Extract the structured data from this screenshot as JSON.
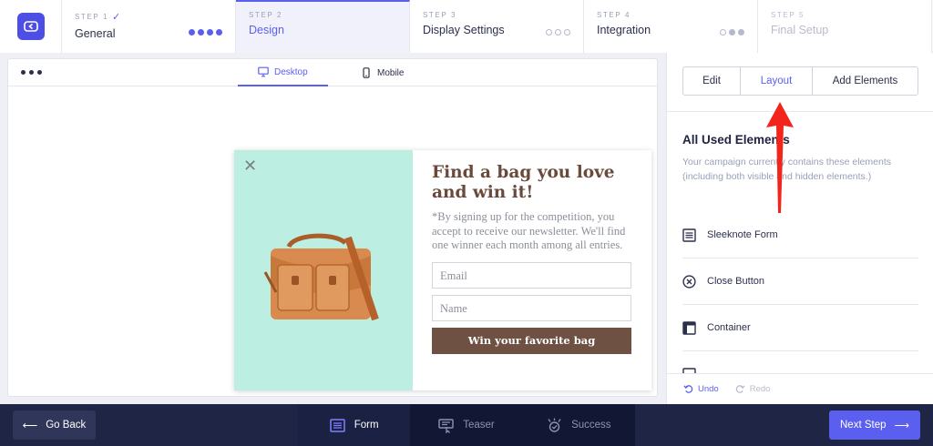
{
  "steps": [
    {
      "label": "STEP 1",
      "name": "General",
      "completed": true,
      "progress_dots": [
        "filled",
        "filled",
        "filled",
        "filled"
      ]
    },
    {
      "label": "STEP 2",
      "name": "Design",
      "active": true
    },
    {
      "label": "STEP 3",
      "name": "Display Settings",
      "progress_dots": [
        "empty",
        "empty",
        "empty"
      ]
    },
    {
      "label": "STEP 4",
      "name": "Integration",
      "progress_dots": [
        "grey",
        "grey",
        "filled-grey"
      ]
    },
    {
      "label": "STEP 5",
      "name": "Final Setup",
      "disabled": true
    }
  ],
  "preview": {
    "device_tabs": [
      {
        "label": "Desktop",
        "icon": "desktop-icon",
        "active": true
      },
      {
        "label": "Mobile",
        "icon": "mobile-icon"
      }
    ],
    "popup": {
      "title": "Find a bag you love and win it!",
      "text": "*By signing up for the competition, you accept to receive our newsletter. We'll find one winner each month among all entries.",
      "email_placeholder": "Email",
      "name_placeholder": "Name",
      "cta": "Win your favorite bag",
      "left_bg": "#bdeee2",
      "cta_color": "#6e5142",
      "title_color": "#6a4a3b"
    }
  },
  "sidebar": {
    "tabs": [
      "Edit",
      "Layout",
      "Add Elements"
    ],
    "active_tab": "Layout",
    "title": "All Used Elements",
    "description": "Your campaign currently contains these elements (including both visible and hidden elements.)",
    "elements": [
      {
        "label": "Sleeknote Form",
        "icon": "form-icon"
      },
      {
        "label": "Close Button",
        "icon": "close-circle-icon"
      },
      {
        "label": "Container",
        "icon": "container-icon"
      }
    ],
    "undo": "Undo",
    "redo": "Redo"
  },
  "bottom": {
    "go_back": "Go Back",
    "tabs": [
      {
        "label": "Form",
        "icon": "form-icon",
        "active": true
      },
      {
        "label": "Teaser",
        "icon": "teaser-icon"
      },
      {
        "label": "Success",
        "icon": "success-icon"
      }
    ],
    "next_step": "Next Step"
  },
  "colors": {
    "accent": "#5b5ff0",
    "bottom_bar": "#1f2545",
    "annotation_arrow": "#f3241c"
  }
}
